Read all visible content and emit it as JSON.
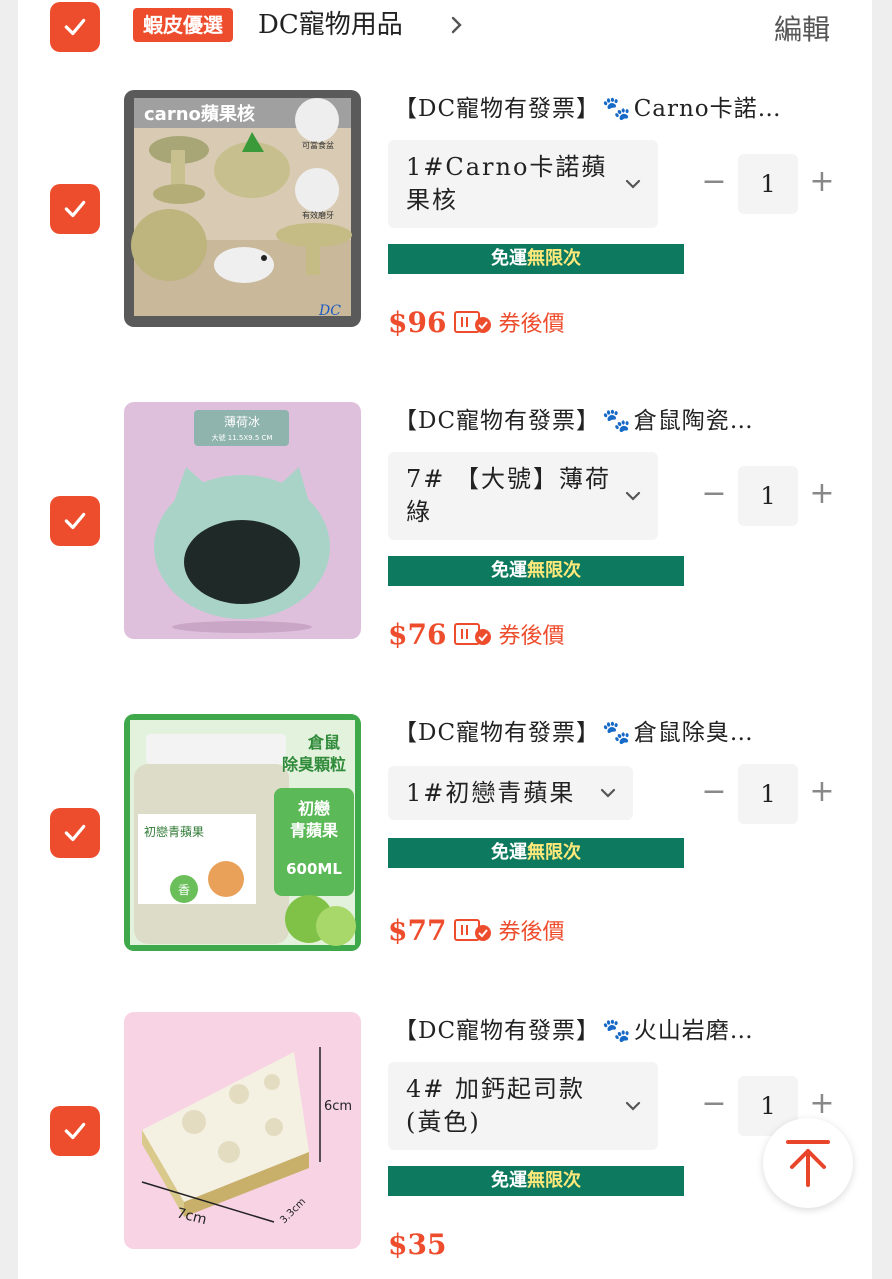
{
  "header": {
    "shop_badge": "蝦皮優選",
    "shop_name": "DC寵物用品",
    "edit_label": "編輯"
  },
  "items": [
    {
      "title_prefix": "【DC寵物有發票】",
      "paw": "🐾",
      "title_suffix": "Carno卡諾…",
      "variant": "1#Carno卡諾蘋果核",
      "quantity": "1",
      "minus": "−",
      "plus": "+",
      "shipping_prefix": "免運",
      "shipping_highlight": "無限次",
      "price": "$96",
      "price_note": "券後價",
      "image_text": {
        "title": "carno蘋果核",
        "a": "可當食盆",
        "b": "有效磨牙",
        "logo": "DC"
      }
    },
    {
      "title_prefix": "【DC寵物有發票】",
      "paw": "🐾",
      "title_suffix": "倉鼠陶瓷…",
      "variant": "7# 【大號】薄荷綠",
      "quantity": "1",
      "minus": "−",
      "plus": "+",
      "shipping_prefix": "免運",
      "shipping_highlight": "無限次",
      "price": "$76",
      "price_note": "券後價",
      "image_text": {
        "title": "薄荷冰",
        "size": "大號 11.5X9.5 CM"
      }
    },
    {
      "title_prefix": "【DC寵物有發票】",
      "paw": "🐾",
      "title_suffix": "倉鼠除臭…",
      "variant": "1#初戀青蘋果",
      "quantity": "1",
      "minus": "−",
      "plus": "+",
      "shipping_prefix": "免運",
      "shipping_highlight": "無限次",
      "price": "$77",
      "price_note": "券後價",
      "image_text": {
        "title1": "倉鼠",
        "title2": "除臭顆粒",
        "flavor1": "初戀",
        "flavor2": "青蘋果",
        "volume": "600ML",
        "label": "初戀青蘋果",
        "tag": "香"
      }
    },
    {
      "title_prefix": "【DC寵物有發票】",
      "paw": "🐾",
      "title_suffix": "火山岩磨…",
      "variant": "4# 加鈣起司款(黃色)",
      "quantity": "1",
      "minus": "−",
      "plus": "+",
      "shipping_prefix": "免運",
      "shipping_highlight": "無限次",
      "price": "$35",
      "price_note": "",
      "image_text": {
        "h": "6cm",
        "w": "7cm",
        "d": "3.3cm"
      }
    }
  ],
  "colors": {
    "accent": "#ee4d2d",
    "shipping_bg": "#0d7a5f",
    "shipping_highlight": "#ffe97a",
    "paw": "#1d8be0"
  },
  "icons": [
    "check-icon",
    "chevron-right-icon",
    "chevron-down-icon",
    "paw-icon",
    "coupon-icon",
    "arrow-up-icon"
  ]
}
